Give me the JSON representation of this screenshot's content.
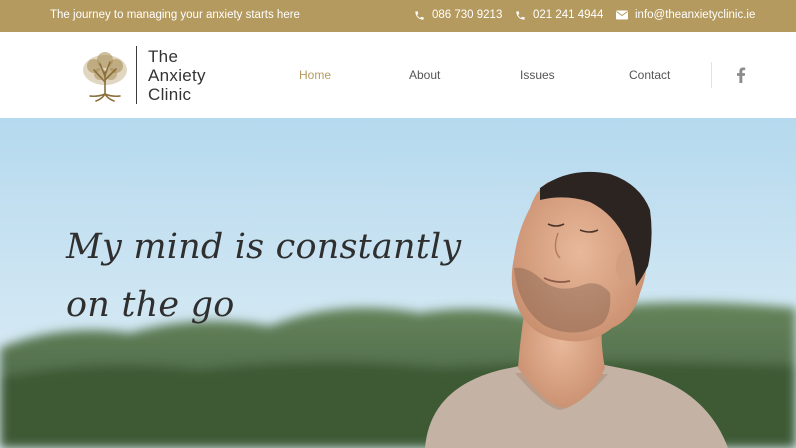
{
  "topbar": {
    "tagline": "The journey to managing your anxiety starts here",
    "phone1": "086 730 9213",
    "phone2": "021 241 4944",
    "email": "info@theanxietyclinic.ie",
    "background_color": "#b59a5f"
  },
  "logo": {
    "line1": "The",
    "line2": "Anxiety",
    "line3": "Clinic",
    "icon": "tree-icon",
    "color": "#a58a4f"
  },
  "nav": {
    "items": [
      {
        "label": "Home",
        "active": true
      },
      {
        "label": "About",
        "active": false
      },
      {
        "label": "Issues",
        "active": false
      },
      {
        "label": "Contact",
        "active": false
      }
    ],
    "active_color": "#b59a5f",
    "social_icon": "facebook-icon"
  },
  "hero": {
    "heading_line1": "My mind is constantly",
    "heading_line2": "on the go",
    "image": "man-breathing-outdoors-photo"
  }
}
